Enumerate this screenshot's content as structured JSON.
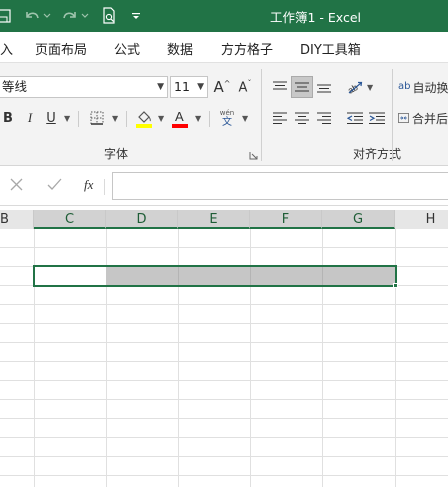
{
  "window": {
    "title": "工作簿1  -  Excel"
  },
  "menu": {
    "items": [
      "入",
      "页面布局",
      "公式",
      "数据",
      "方方格子",
      "DIY工具箱"
    ]
  },
  "ribbon": {
    "font_name": "等线",
    "font_size": "11",
    "grow_font": "A^",
    "shrink_font": "Aˇ",
    "bold": "B",
    "italic": "I",
    "underline": "U",
    "wen": "wén",
    "wen_char": "文",
    "font_group_label": "字体",
    "align_group_label": "对齐方式",
    "wrap_text_label": "自动换",
    "merge_label": "合并后",
    "wrap_icon_text": "ab",
    "colors": {
      "highlight": "#ffff00",
      "font_color": "#ff0000"
    }
  },
  "formula_bar": {
    "fx_label": "fx",
    "value": ""
  },
  "grid": {
    "columns": [
      "B",
      "C",
      "D",
      "E",
      "F",
      "G",
      "H"
    ],
    "selected_columns": [
      "C",
      "D",
      "E",
      "F",
      "G"
    ],
    "selection_range": "C3:G3",
    "active_cell": "C3"
  }
}
